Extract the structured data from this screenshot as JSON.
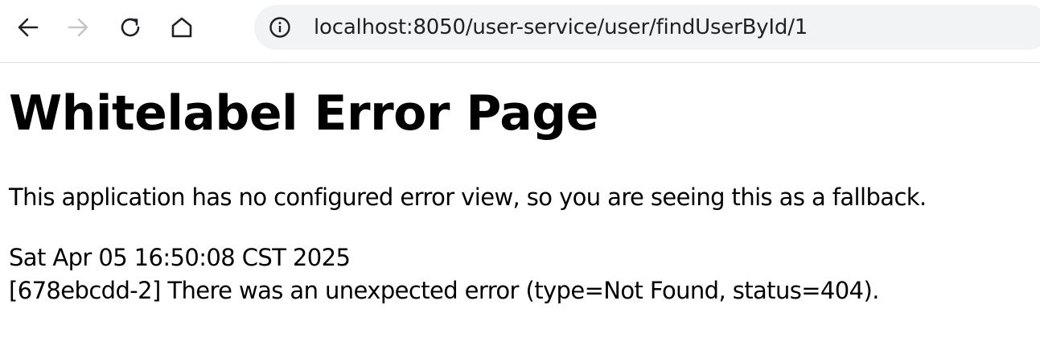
{
  "browser": {
    "address_bar": {
      "url": "localhost:8050/user-service/user/findUserById/1",
      "site_info_icon": "info-icon"
    },
    "nav_icons": [
      "back-arrow-icon",
      "forward-arrow-icon",
      "reload-icon",
      "home-icon"
    ],
    "colors": {
      "toolbar_bg": "#ffffff",
      "omnibox_bg": "#f1f3f4",
      "icon_active": "#202124",
      "icon_disabled": "#c4c7ca"
    }
  },
  "page": {
    "title": "Whitelabel Error Page",
    "description": "This application has no configured error view, so you are seeing this as a fallback.",
    "timestamp": "Sat Apr 05 16:50:08 CST 2025",
    "error_message": "[678ebcdd-2] There was an unexpected error (type=Not Found, status=404)."
  }
}
